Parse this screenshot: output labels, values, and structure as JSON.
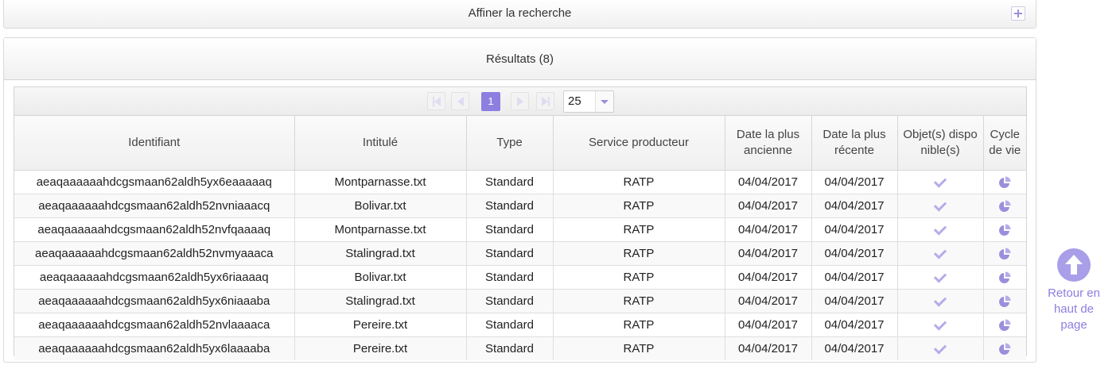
{
  "refine": {
    "title": "Affiner la recherche"
  },
  "results": {
    "title": "Résultats (8)",
    "pager": {
      "current_page": "1",
      "page_size": "25"
    },
    "columns": [
      "Identifiant",
      "Intitulé",
      "Type",
      "Service producteur",
      "Date la plus ancienne",
      "Date la plus récente",
      "Objet(s) disponible(s)",
      "Cycle de vie"
    ],
    "rows": [
      {
        "id": "aeaqaaaaaahdcgsmaan62aldh5yx6eaaaaaq",
        "title": "Montparnasse.txt",
        "type": "Standard",
        "service": "RATP",
        "oldest": "04/04/2017",
        "newest": "04/04/2017"
      },
      {
        "id": "aeaqaaaaaahdcgsmaan62aldh52nvniaaacq",
        "title": "Bolivar.txt",
        "type": "Standard",
        "service": "RATP",
        "oldest": "04/04/2017",
        "newest": "04/04/2017"
      },
      {
        "id": "aeaqaaaaaahdcgsmaan62aldh52nvfqaaaaq",
        "title": "Montparnasse.txt",
        "type": "Standard",
        "service": "RATP",
        "oldest": "04/04/2017",
        "newest": "04/04/2017"
      },
      {
        "id": "aeaqaaaaaahdcgsmaan62aldh52nvmyaaaca",
        "title": "Stalingrad.txt",
        "type": "Standard",
        "service": "RATP",
        "oldest": "04/04/2017",
        "newest": "04/04/2017"
      },
      {
        "id": "aeaqaaaaaahdcgsmaan62aldh5yx6riaaaaq",
        "title": "Bolivar.txt",
        "type": "Standard",
        "service": "RATP",
        "oldest": "04/04/2017",
        "newest": "04/04/2017"
      },
      {
        "id": "aeaqaaaaaahdcgsmaan62aldh5yx6niaaaba",
        "title": "Stalingrad.txt",
        "type": "Standard",
        "service": "RATP",
        "oldest": "04/04/2017",
        "newest": "04/04/2017"
      },
      {
        "id": "aeaqaaaaaahdcgsmaan62aldh52nvlaaaaca",
        "title": "Pereire.txt",
        "type": "Standard",
        "service": "RATP",
        "oldest": "04/04/2017",
        "newest": "04/04/2017"
      },
      {
        "id": "aeaqaaaaaahdcgsmaan62aldh5yx6laaaaba",
        "title": "Pereire.txt",
        "type": "Standard",
        "service": "RATP",
        "oldest": "04/04/2017",
        "newest": "04/04/2017"
      }
    ],
    "row_icons": {
      "available": "check-icon",
      "lifecycle": "pie-chart-icon"
    }
  },
  "back_to_top": {
    "label": "Retour en haut de page",
    "icon": "arrow-up-circle-icon"
  },
  "colors": {
    "accent": "#8c7fe0",
    "icon_light": "#b6acea"
  }
}
